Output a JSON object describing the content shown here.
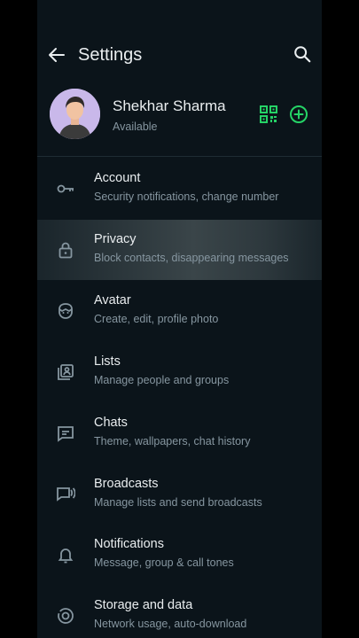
{
  "header": {
    "title": "Settings"
  },
  "profile": {
    "name": "Shekhar Sharma",
    "status": "Available"
  },
  "colors": {
    "background": "#0b141a",
    "accent": "#25d366",
    "text_primary": "#e9edef",
    "text_secondary": "#8696a0"
  },
  "items": [
    {
      "icon": "key-icon",
      "title": "Account",
      "subtitle": "Security notifications, change number"
    },
    {
      "icon": "lock-icon",
      "title": "Privacy",
      "subtitle": "Block contacts, disappearing messages"
    },
    {
      "icon": "avatar-face-icon",
      "title": "Avatar",
      "subtitle": "Create, edit, profile photo"
    },
    {
      "icon": "lists-icon",
      "title": "Lists",
      "subtitle": "Manage people and groups"
    },
    {
      "icon": "chat-icon",
      "title": "Chats",
      "subtitle": "Theme, wallpapers, chat history"
    },
    {
      "icon": "broadcast-icon",
      "title": "Broadcasts",
      "subtitle": "Manage lists and send broadcasts"
    },
    {
      "icon": "bell-icon",
      "title": "Notifications",
      "subtitle": "Message, group & call tones"
    },
    {
      "icon": "storage-icon",
      "title": "Storage and data",
      "subtitle": "Network usage, auto-download"
    }
  ]
}
